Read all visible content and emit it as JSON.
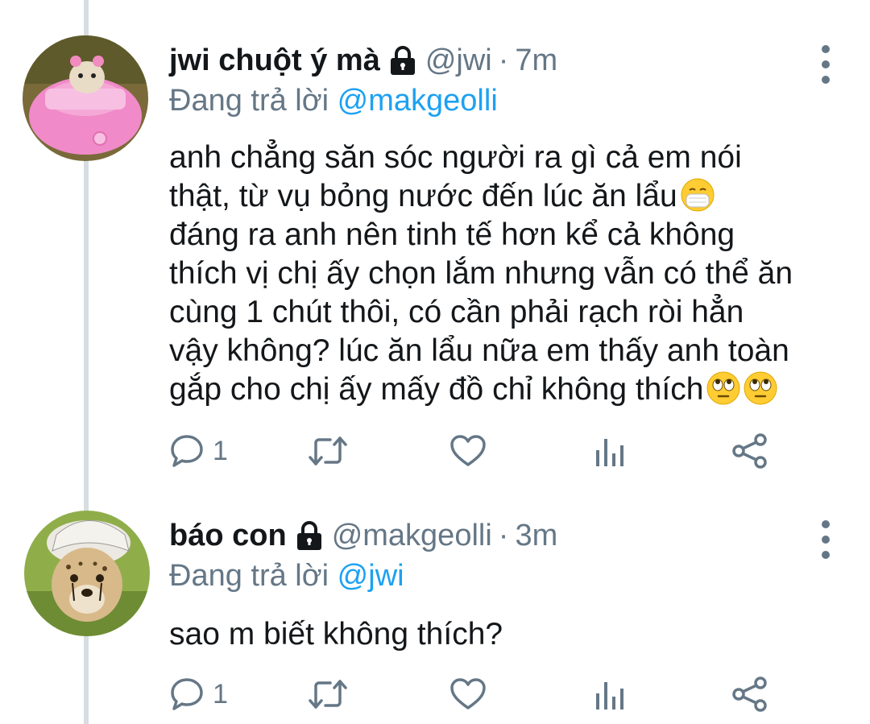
{
  "tweets": [
    {
      "display_name": "jwi chuột ý mà",
      "handle": "@jwi",
      "separator": "·",
      "time": "7m",
      "reply_prefix": "Đang trả lời",
      "reply_to": "@makgeolli",
      "text_lines": [
        "anh chẳng săn sóc người ra gì cả em nói",
        "thật, từ vụ bỏng nước đến lúc ăn lẩu",
        "đáng ra anh nên tinh tế hơn kể cả không",
        "thích vị chị ấy chọn lắm nhưng vẫn có thể ăn",
        "cùng 1 chút thôi, có cần phải rạch ròi hẳn",
        "vậy không? lúc ăn lẩu nữa em thấy anh toàn",
        "gắp cho chị ấy mấy đồ chỉ không thích"
      ],
      "emojis": [
        "face-with-medical-mask",
        "face-with-rolling-eyes",
        "face-with-rolling-eyes"
      ],
      "reply_count": "1",
      "avatar": "hamster-in-pink-car"
    },
    {
      "display_name": "báo con",
      "handle": "@makgeolli",
      "separator": "·",
      "time": "3m",
      "reply_prefix": "Đang trả lời",
      "reply_to": "@jwi",
      "text_lines": [
        "sao m biết không thích?"
      ],
      "reply_count": "1",
      "avatar": "cheetah-cub-with-cap"
    }
  ],
  "icons": [
    "lock-icon",
    "more-icon",
    "reply-icon",
    "retweet-icon",
    "like-icon",
    "stats-icon",
    "share-icon"
  ],
  "colors": {
    "text": "#14171a",
    "secondary": "#657786",
    "link": "#1da1f2",
    "thread_line": "#d7dde2"
  }
}
